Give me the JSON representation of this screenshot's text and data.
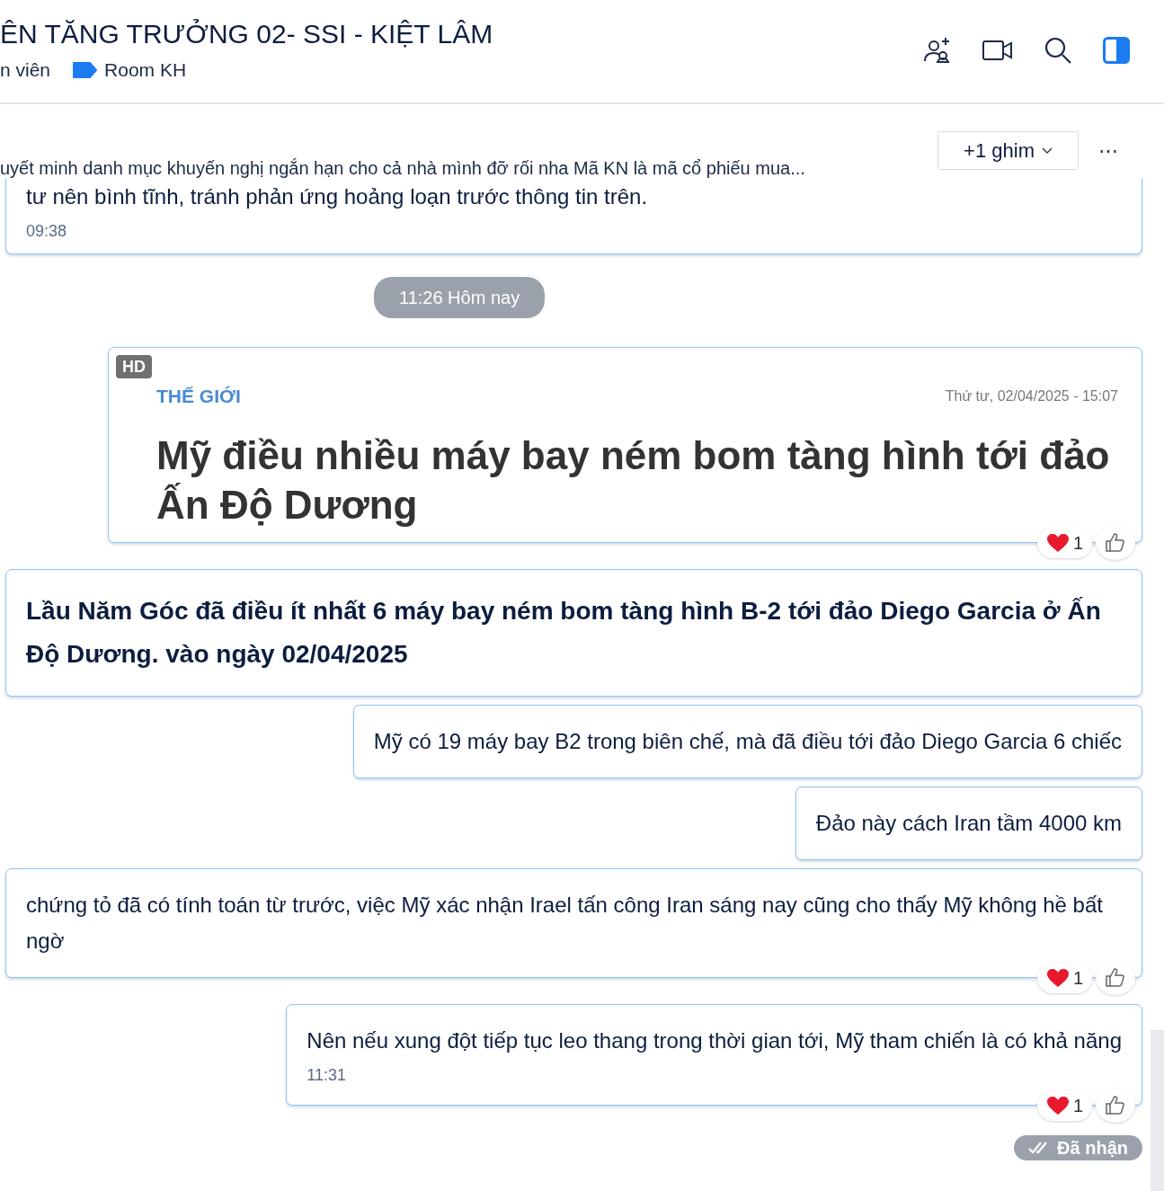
{
  "header": {
    "title": "ÊN TĂNG TRƯỞNG 02- SSI - KIỆT LÂM",
    "members": "n viên",
    "tag": "Room KH"
  },
  "pinned": {
    "text": "uyết minh danh mục khuyến nghị ngắn hạn cho cả nhà mình đỡ rối nha Mã KN là mã cổ phiếu mua...",
    "more_pins": "+1 ghim",
    "menu": "⋯"
  },
  "messages": [
    {
      "kind": "text",
      "text": "tư nên bình tĩnh, tránh phản ứng hoảng loạn trước thông tin trên.",
      "bold": false,
      "time": "09:38"
    },
    {
      "kind": "separator",
      "text": "11:26 Hôm nay"
    },
    {
      "kind": "article",
      "badge": "HD",
      "category": "THẾ GIỚI",
      "date": "Thứ tư, 02/04/2025 - 15:07",
      "title": "Mỹ điều nhiều máy bay ném bom tàng hình tới đảo Ấn Độ Dương",
      "reactions": {
        "count": "1"
      }
    },
    {
      "kind": "text",
      "text": "Lầu Năm Góc đã điều ít nhất 6 máy bay ném bom tàng hình B-2 tới đảo Diego Garcia ở Ấn Độ Dương. vào ngày 02/04/2025",
      "bold": true
    },
    {
      "kind": "text",
      "text": "Mỹ có 19 máy bay B2 trong biên chế, mà đã điều tới đảo Diego Garcia 6 chiếc",
      "bold": false
    },
    {
      "kind": "text",
      "text": "Đảo này cách Iran tầm 4000 km",
      "bold": false
    },
    {
      "kind": "text",
      "text": "chứng tỏ đã có tính toán từ trước, việc Mỹ xác nhận Irael tấn công Iran sáng nay cũng cho thấy Mỹ không hề bất ngờ",
      "bold": false,
      "reactions": {
        "count": "1"
      }
    },
    {
      "kind": "text",
      "text": "Nên nếu xung đột tiếp tục leo thang trong thời gian tới, Mỹ tham chiến là có khả năng",
      "bold": false,
      "time": "11:31",
      "reactions": {
        "count": "1"
      }
    }
  ],
  "status": "Đã nhận"
}
